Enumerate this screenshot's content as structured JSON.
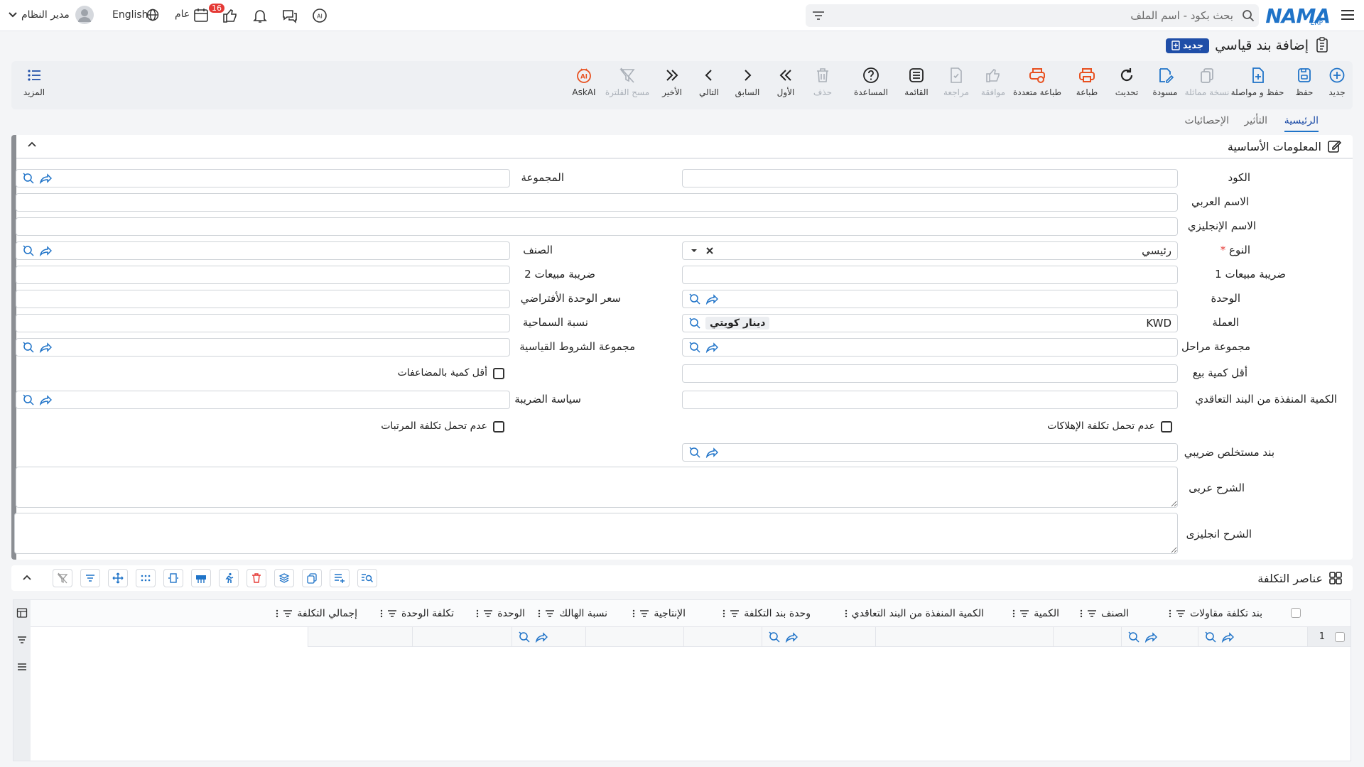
{
  "topbar": {
    "logo_text": "NAMA",
    "logo_sub": "ERP",
    "search_placeholder": "بحث بكود - اسم الملف",
    "language": "English",
    "year_label": "عام",
    "likes_badge": "16",
    "user_name": "مدير النظام"
  },
  "page": {
    "title": "إضافة بند قياسي",
    "status_tag": "جديد"
  },
  "toolbar": {
    "items": [
      {
        "label": "جديد",
        "icon": "plus-circle-icon"
      },
      {
        "label": "حفظ",
        "icon": "save-icon"
      },
      {
        "label": "حفظ و مواصلة",
        "icon": "save-continue-icon"
      },
      {
        "label": "نسخة مماثلة",
        "icon": "copy-icon"
      },
      {
        "label": "مسودة",
        "icon": "draft-edit-icon"
      },
      {
        "label": "تحديث",
        "icon": "refresh-icon"
      },
      {
        "label": "طباعة",
        "icon": "print-icon"
      },
      {
        "label": "طباعة متعددة",
        "icon": "multi-print-icon"
      },
      {
        "label": "موافقة",
        "icon": "thumbs-up-icon"
      },
      {
        "label": "مراجعة",
        "icon": "review-icon"
      },
      {
        "label": "القائمة",
        "icon": "list-icon"
      },
      {
        "label": "المساعدة",
        "icon": "help-icon"
      },
      {
        "label": "حذف",
        "icon": "trash-icon"
      },
      {
        "label": "الأول",
        "icon": "first-icon"
      },
      {
        "label": "السابق",
        "icon": "previous-icon"
      },
      {
        "label": "التالي",
        "icon": "next-icon"
      },
      {
        "label": "الأخير",
        "icon": "last-icon"
      },
      {
        "label": "مسح الفلترة",
        "icon": "clear-filter-icon"
      },
      {
        "label": "AskAI",
        "icon": "ai-icon"
      }
    ],
    "more_label": "المزيد"
  },
  "tabs": [
    "الرئيسية",
    "التأثير",
    "الإحصائيات"
  ],
  "section": {
    "title": "المعلومات الأساسية"
  },
  "form": {
    "code": "الكود",
    "group": "المجموعة",
    "name_ar": "الاسم العربي",
    "name_en": "الاسم الإنجليزي",
    "type": "النوع",
    "type_value": "رئيسي",
    "category": "الصنف",
    "sales_tax1": "ضريبة مبيعات 1",
    "sales_tax2": "ضريبة مبيعات 2",
    "unit": "الوحدة",
    "default_unit_price": "سعر الوحدة الأفتراضي",
    "currency": "العملة",
    "currency_code": "KWD",
    "currency_name": "دينار كويتي",
    "tolerance_rate": "نسبة السماحية",
    "stages_group": "مجموعة مراحل",
    "standard_terms_group": "مجموعة الشروط القياسية",
    "min_sale_qty": "أقل كمية بيع",
    "min_qty_multiples": "أقل كمية بالمضاعفات",
    "executed_qty": "الكمية المنفذة من البند التعاقدي",
    "tax_policy": "سياسة الضريبة",
    "no_depreciation_cost": "عدم تحمل تكلفة الإهلاكات",
    "no_salaries_cost": "عدم تحمل تكلفة المرتبات",
    "tax_extract_item": "بند مستخلص ضريبي",
    "desc_ar": "الشرح عربى",
    "desc_en": "الشرح انجليزى"
  },
  "cost_grid": {
    "title": "عناصر التكلفة",
    "columns": [
      "بند تكلفة مقاولات",
      "الصنف",
      "الكمية",
      "الكمية المنفذة من البند التعاقدي",
      "وحدة بند التكلفة",
      "الإنتاجية",
      "نسبة الهالك",
      "الوحدة",
      "تكلفة الوحدة",
      "إجمالي التكلفة"
    ],
    "rows": [
      {
        "num": "1"
      }
    ]
  },
  "colors": {
    "brand": "#1f73c8",
    "accent_dark": "#1f4ea8",
    "print_orange": "#e8501f",
    "danger": "#e53935"
  }
}
